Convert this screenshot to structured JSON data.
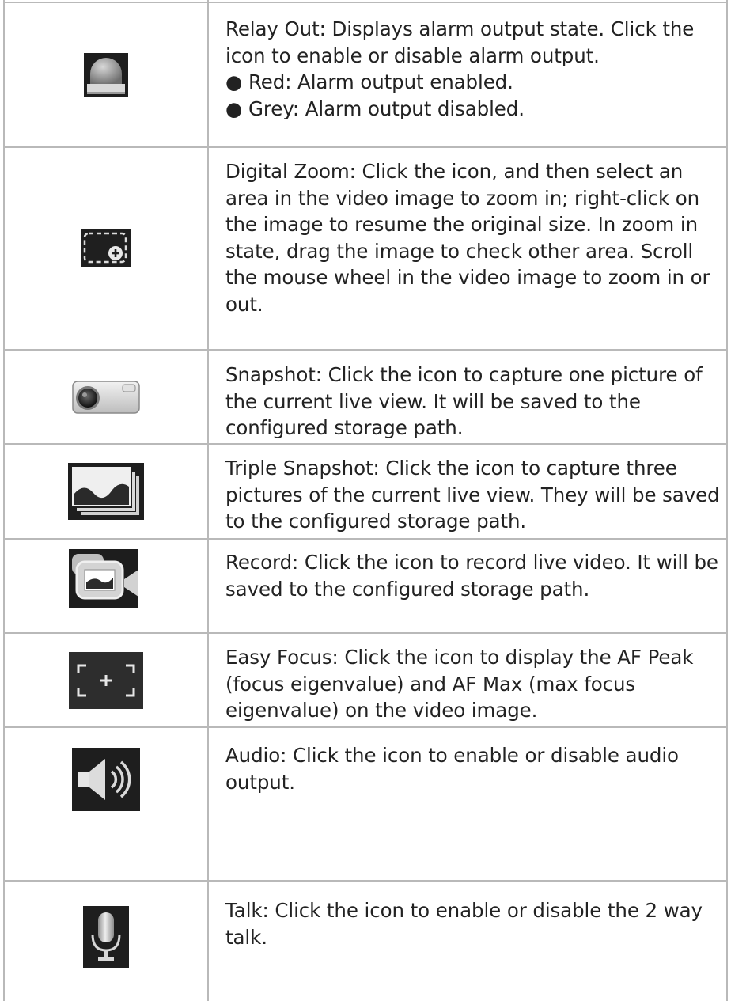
{
  "rows": [
    {
      "icon": "alarm-light-icon",
      "description": "Relay Out: Displays alarm output state. Click the icon to enable or disable alarm output.",
      "bullets": [
        "● Red: Alarm output enabled.",
        "● Grey: Alarm output disabled."
      ]
    },
    {
      "icon": "digital-zoom-icon",
      "description": "Digital Zoom: Click the icon, and then select an area in the video image to zoom in; right-click on the image to resume the original size. In zoom in state, drag the image to check other area. Scroll the mouse wheel in the video image to zoom in or out."
    },
    {
      "icon": "camera-icon",
      "description": "Snapshot: Click the icon to capture one picture of the current live view. It will be saved to the configured storage path."
    },
    {
      "icon": "triple-snapshot-icon",
      "description": "Triple Snapshot: Click the icon to capture three pictures of the current live view. They will be saved to the configured storage path."
    },
    {
      "icon": "video-camera-icon",
      "description": "Record: Click the icon to record live video. It will be saved to the configured storage path."
    },
    {
      "icon": "easy-focus-icon",
      "description": "Easy Focus: Click the icon to display the AF Peak (focus eigenvalue) and AF Max (max focus eigenvalue) on the video image."
    },
    {
      "icon": "speaker-icon",
      "description": "Audio: Click the icon to enable or disable audio output."
    },
    {
      "icon": "microphone-icon",
      "description": "Talk: Click the icon to enable or disable the 2 way talk."
    }
  ],
  "colors": {
    "border": "#b9b9b9",
    "text": "#222222",
    "icon_dark": "#2b2b2b",
    "icon_grey": "#9a9a9a"
  }
}
